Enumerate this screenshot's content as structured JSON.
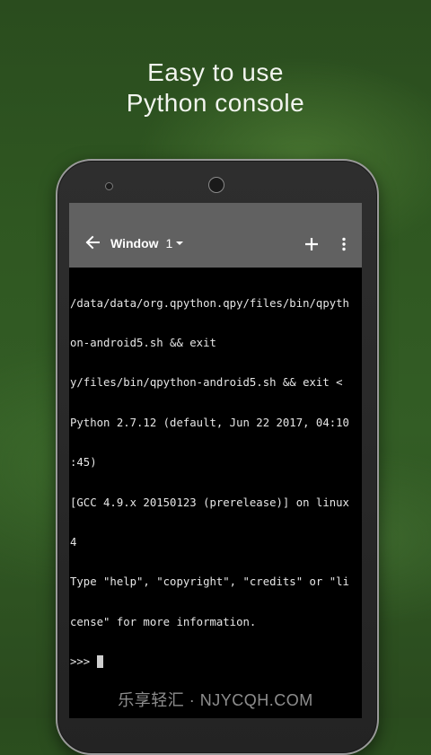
{
  "headline": {
    "line1": "Easy to use",
    "line2": "Python console"
  },
  "app_bar": {
    "title": "Window",
    "window_number": "1",
    "icons": {
      "back": "arrow-left-icon",
      "dropdown": "caret-down-icon",
      "add": "plus-icon",
      "menu": "more-vertical-icon"
    },
    "background": "#616161"
  },
  "terminal": {
    "lines": [
      "/data/data/org.qpython.qpy/files/bin/qpyth",
      "on-android5.sh && exit",
      "y/files/bin/qpython-android5.sh && exit <",
      "Python 2.7.12 (default, Jun 22 2017, 04:10",
      ":45)",
      "[GCC 4.9.x 20150123 (prerelease)] on linux",
      "4",
      "Type \"help\", \"copyright\", \"credits\" or \"li",
      "cense\" for more information."
    ],
    "prompt": ">>> "
  },
  "watermark": "乐享轻汇 · NJYCQH.COM"
}
